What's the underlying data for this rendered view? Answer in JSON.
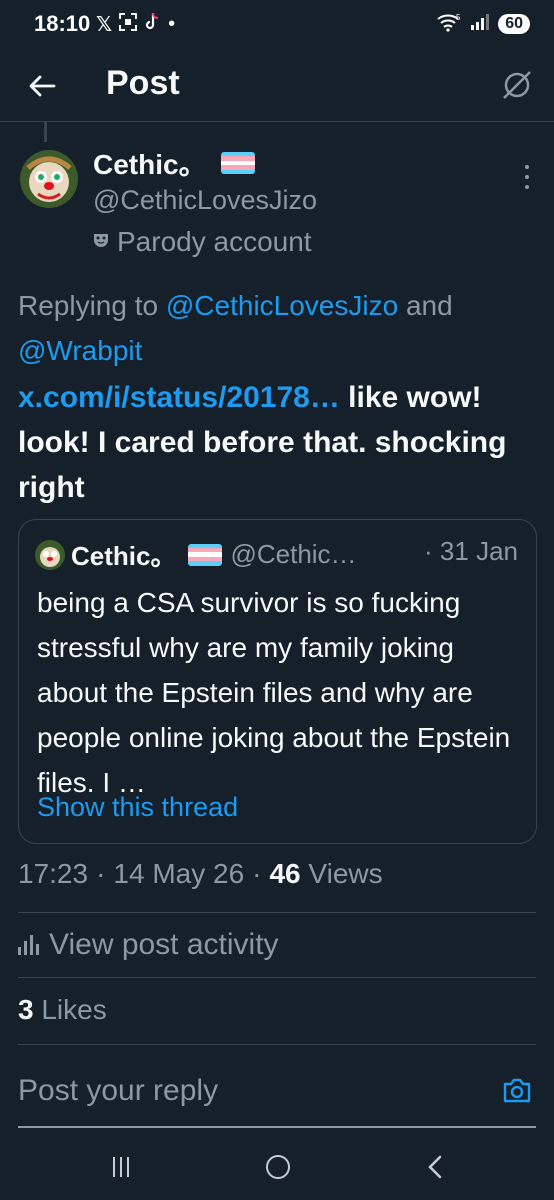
{
  "status_bar": {
    "time": "18:10",
    "notif_icons": [
      "x-logo-icon",
      "screenshot-icon",
      "tiktok-icon",
      "dot-icon"
    ],
    "battery": "60"
  },
  "header": {
    "title": "Post"
  },
  "post": {
    "author_name": "Cethic。",
    "author_handle": "@CethicLovesJizo",
    "parody_label": "Parody account",
    "replying_prefix": "Replying to",
    "replying_mention_1": "@CethicLovesJizo",
    "replying_and": "and",
    "replying_mention_2": "@Wrabpit",
    "link_text": "x.com/i/status/20178…",
    "body_text": "like wow! look! I cared before that. shocking right"
  },
  "quote": {
    "name": "Cethic。",
    "handle": "@Cethic…",
    "date": "· 31 Jan",
    "text": "being a CSA survivor is so fucking stressful why are my family joking about the Epstein files and why are people online joking about the Epstein files. I …",
    "show_thread": "Show this thread"
  },
  "meta": {
    "time": "17:23",
    "date": "14 May 26",
    "views_count": "46",
    "views_label": "Views",
    "separator": "·"
  },
  "activity_label": "View post activity",
  "likes": {
    "count": "3",
    "label": "Likes"
  },
  "reply": {
    "placeholder": "Post your reply"
  },
  "colors": {
    "background": "#15202b",
    "accent": "#1d9bf0",
    "secondary_text": "#8b98a5",
    "border": "#38444d",
    "flag": [
      "#5bcefa",
      "#f5a9b8",
      "#ffffff",
      "#f5a9b8",
      "#5bcefa"
    ]
  }
}
